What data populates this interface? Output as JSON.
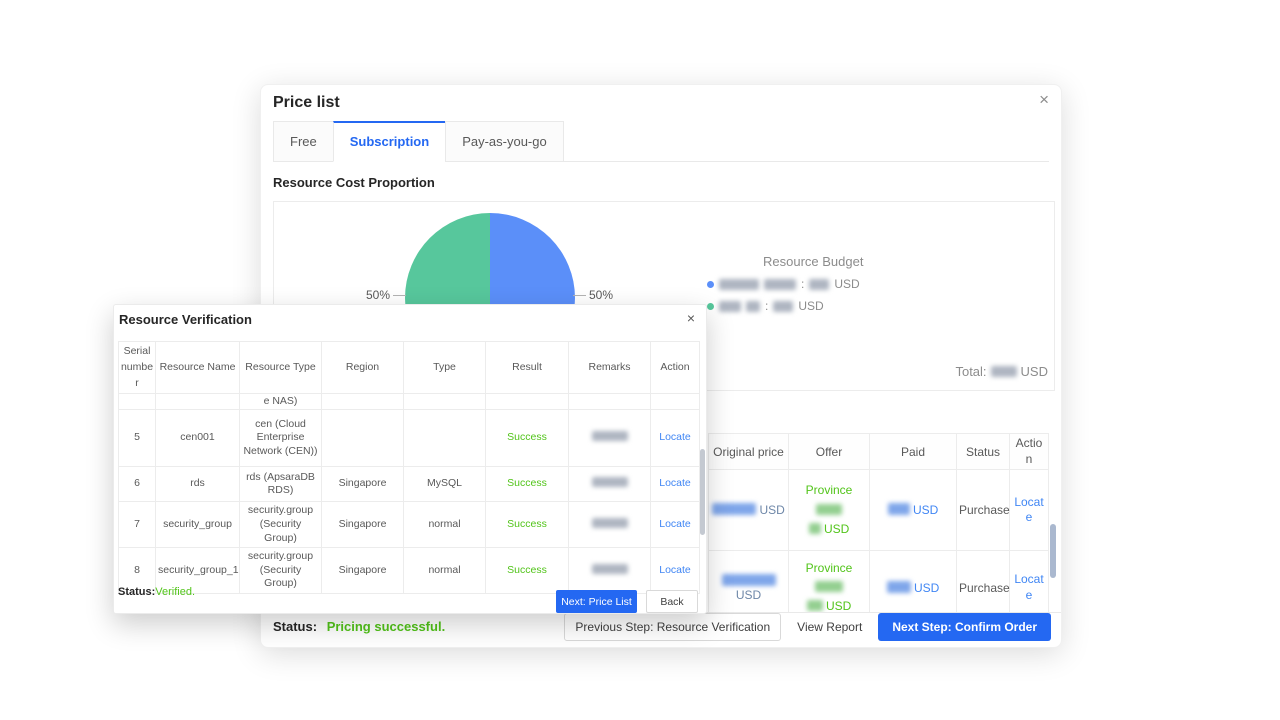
{
  "chart_data": {
    "type": "pie",
    "title": "Resource Cost Proportion",
    "labels": [
      "50%",
      "50%"
    ],
    "values": [
      50,
      50
    ],
    "colors": [
      "#57C79C",
      "#5B8FF9"
    ],
    "legend_position": "right",
    "legend_title": "Resource Budget"
  },
  "price_list": {
    "title": "Price list",
    "close_icon": "×",
    "tabs": [
      {
        "label": "Free"
      },
      {
        "label": "Subscription"
      },
      {
        "label": "Pay-as-you-go"
      }
    ],
    "active_tab": "Subscription",
    "section_title": "Resource Cost Proportion",
    "budget": {
      "title": "Resource Budget",
      "colon": ":",
      "currency": "USD",
      "item_colors": [
        "#5B8FF9",
        "#57C79C"
      ],
      "total_label": "Total:",
      "total_suffix": "USD"
    },
    "order_table": {
      "columns": [
        "Original price",
        "Offer",
        "Paid",
        "Status",
        "Action"
      ],
      "rows": [
        {
          "original_suffix": "USD",
          "offer_prefix": "Province",
          "offer_suffix": "USD",
          "paid_suffix": "USD",
          "status": "Purchase",
          "action": "Locate"
        },
        {
          "original_suffix": "USD",
          "offer_prefix": "Province",
          "offer_suffix": "USD",
          "paid_suffix": "USD",
          "status": "Purchase",
          "action": "Locate"
        }
      ]
    },
    "footer": {
      "status_label": "Status:",
      "status_value": "Pricing successful.",
      "prev_button": "Previous Step: Resource Verification",
      "view_report_button": "View Report",
      "next_button": "Next Step: Confirm Order"
    }
  },
  "verification": {
    "title": "Resource Verification",
    "close_icon": "×",
    "columns": [
      "Serial number",
      "Resource Name",
      "Resource Type",
      "Region",
      "Type",
      "Result",
      "Remarks",
      "Action"
    ],
    "partial_row_text": "e NAS)",
    "rows": [
      {
        "serial": "5",
        "name": "cen001",
        "type": "cen (Cloud Enterprise Network (CEN))",
        "region": "",
        "kind": "",
        "result": "Success",
        "action": "Locate"
      },
      {
        "serial": "6",
        "name": "rds",
        "type": "rds (ApsaraDB RDS)",
        "region": "Singapore",
        "kind": "MySQL",
        "result": "Success",
        "action": "Locate"
      },
      {
        "serial": "7",
        "name": "security_group",
        "type": "security.group (Security Group)",
        "region": "Singapore",
        "kind": "normal",
        "result": "Success",
        "action": "Locate"
      },
      {
        "serial": "8",
        "name": "security_group_1",
        "type": "security.group (Security Group)",
        "region": "Singapore",
        "kind": "normal",
        "result": "Success",
        "action": "Locate"
      }
    ],
    "status_label": "Status:",
    "status_value": "Verified.",
    "next_button": "Next: Price List",
    "back_button": "Back"
  }
}
